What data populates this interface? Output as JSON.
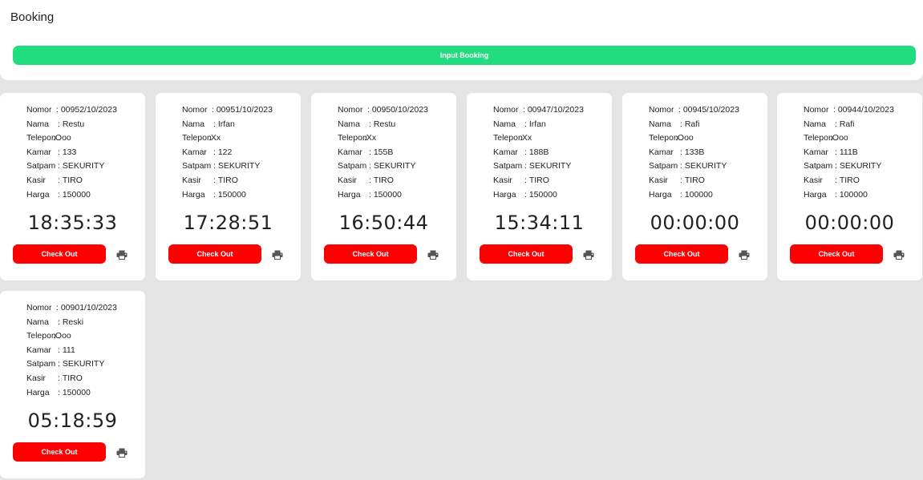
{
  "header": {
    "title": "Booking",
    "input_booking_label": "Input Booking"
  },
  "labels": {
    "nomor": "Nomor",
    "nama": "Nama",
    "telepon": "Telepon",
    "kamar": "Kamar",
    "satpam": "Satpam",
    "kasir": "Kasir",
    "harga": "Harga"
  },
  "checkout_label": "Check Out",
  "print_icon": "printer-icon",
  "colors": {
    "input_booking": "#22dd7f",
    "checkout": "#ff0000",
    "background": "#e4e4e4"
  },
  "bookings": [
    {
      "nomor": "00952/10/2023",
      "nama": "Restu",
      "telepon": "Ooo",
      "kamar": "133",
      "satpam": "SEKURITY",
      "kasir": "TIRO",
      "harga": "150000",
      "timer": "18:35:33"
    },
    {
      "nomor": "00951/10/2023",
      "nama": "Irfan",
      "telepon": "Xx",
      "kamar": "122",
      "satpam": "SEKURITY",
      "kasir": "TIRO",
      "harga": "150000",
      "timer": "17:28:51"
    },
    {
      "nomor": "00950/10/2023",
      "nama": "Restu",
      "telepon": "Xx",
      "kamar": "155B",
      "satpam": "SEKURITY",
      "kasir": "TIRO",
      "harga": "150000",
      "timer": "16:50:44"
    },
    {
      "nomor": "00947/10/2023",
      "nama": "Irfan",
      "telepon": "Xx",
      "kamar": "188B",
      "satpam": "SEKURITY",
      "kasir": "TIRO",
      "harga": "150000",
      "timer": "15:34:11"
    },
    {
      "nomor": "00945/10/2023",
      "nama": "Rafi",
      "telepon": "Ooo",
      "kamar": "133B",
      "satpam": "SEKURITY",
      "kasir": "TIRO",
      "harga": "100000",
      "timer": "00:00:00"
    },
    {
      "nomor": "00944/10/2023",
      "nama": "Rafi",
      "telepon": "Ooo",
      "kamar": "111B",
      "satpam": "SEKURITY",
      "kasir": "TIRO",
      "harga": "100000",
      "timer": "00:00:00"
    },
    {
      "nomor": "00901/10/2023",
      "nama": "Reski",
      "telepon": "Ooo",
      "kamar": "111",
      "satpam": "SEKURITY",
      "kasir": "TIRO",
      "harga": "150000",
      "timer": "05:18:59"
    }
  ]
}
